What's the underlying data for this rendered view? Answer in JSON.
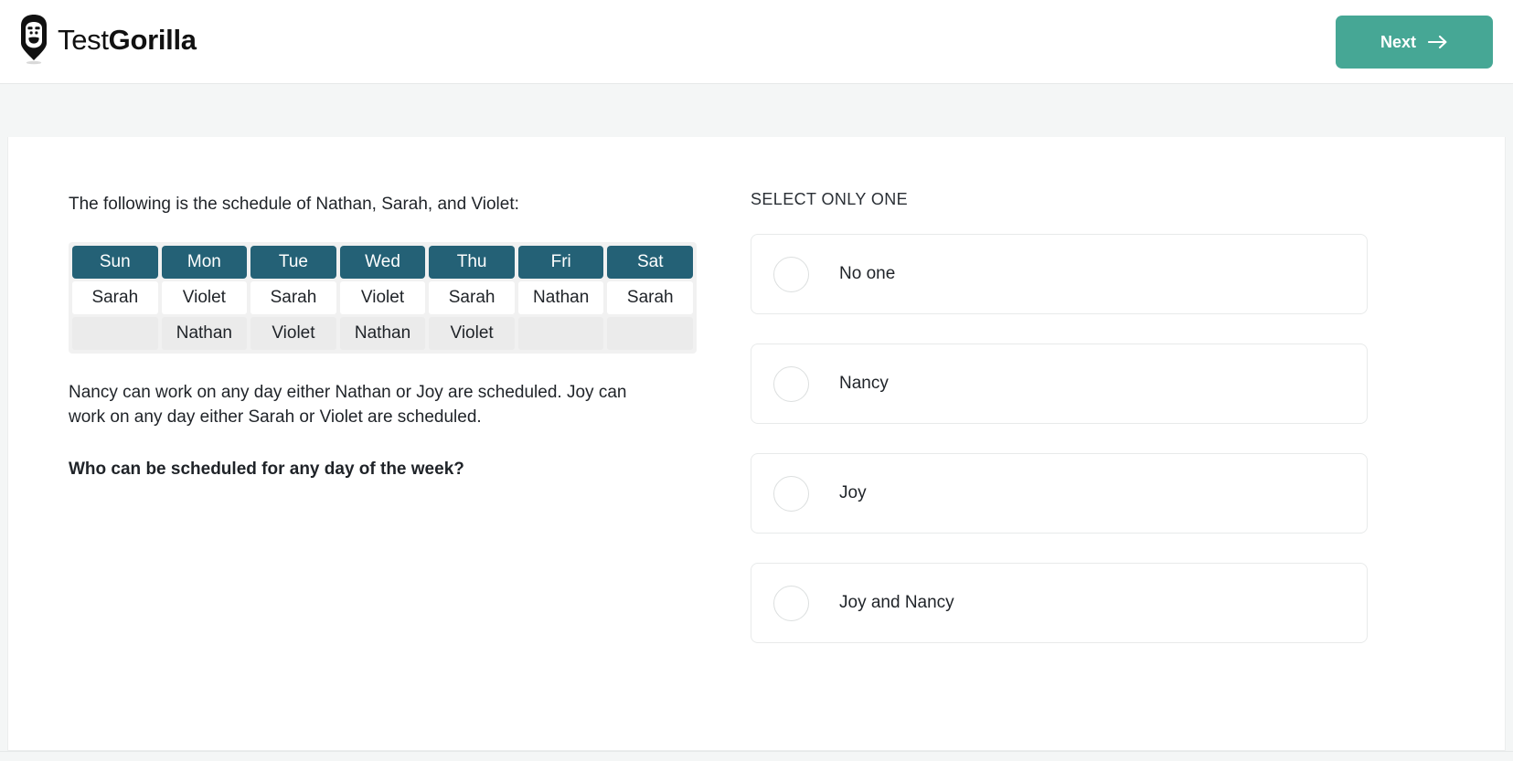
{
  "brand": {
    "name_light": "Test",
    "name_bold": "Gorilla",
    "logo_icon": "gorilla-logo-icon"
  },
  "header": {
    "next_label": "Next",
    "next_icon": "arrow-right-icon",
    "next_color": "#46a795"
  },
  "stimulus": {
    "intro": "The following is the schedule of Nathan, Sarah, and Violet:",
    "schedule": {
      "header_color": "#246176",
      "days": [
        "Sun",
        "Mon",
        "Tue",
        "Wed",
        "Thu",
        "Fri",
        "Sat"
      ],
      "rows": [
        [
          "Sarah",
          "Violet",
          "Sarah",
          "Violet",
          "Sarah",
          "Nathan",
          "Sarah"
        ],
        [
          "",
          "Nathan",
          "Violet",
          "Nathan",
          "Violet",
          "",
          ""
        ]
      ]
    },
    "paragraph": "Nancy can work on any day either Nathan or Joy are scheduled. Joy can work on any day either Sarah or Violet are scheduled.",
    "question": "Who can be scheduled for any day of the week?"
  },
  "answers": {
    "instruction": "SELECT ONLY ONE",
    "options": [
      {
        "label": "No one",
        "selected": false
      },
      {
        "label": "Nancy",
        "selected": false
      },
      {
        "label": "Joy",
        "selected": false
      },
      {
        "label": "Joy and Nancy",
        "selected": false
      }
    ]
  }
}
